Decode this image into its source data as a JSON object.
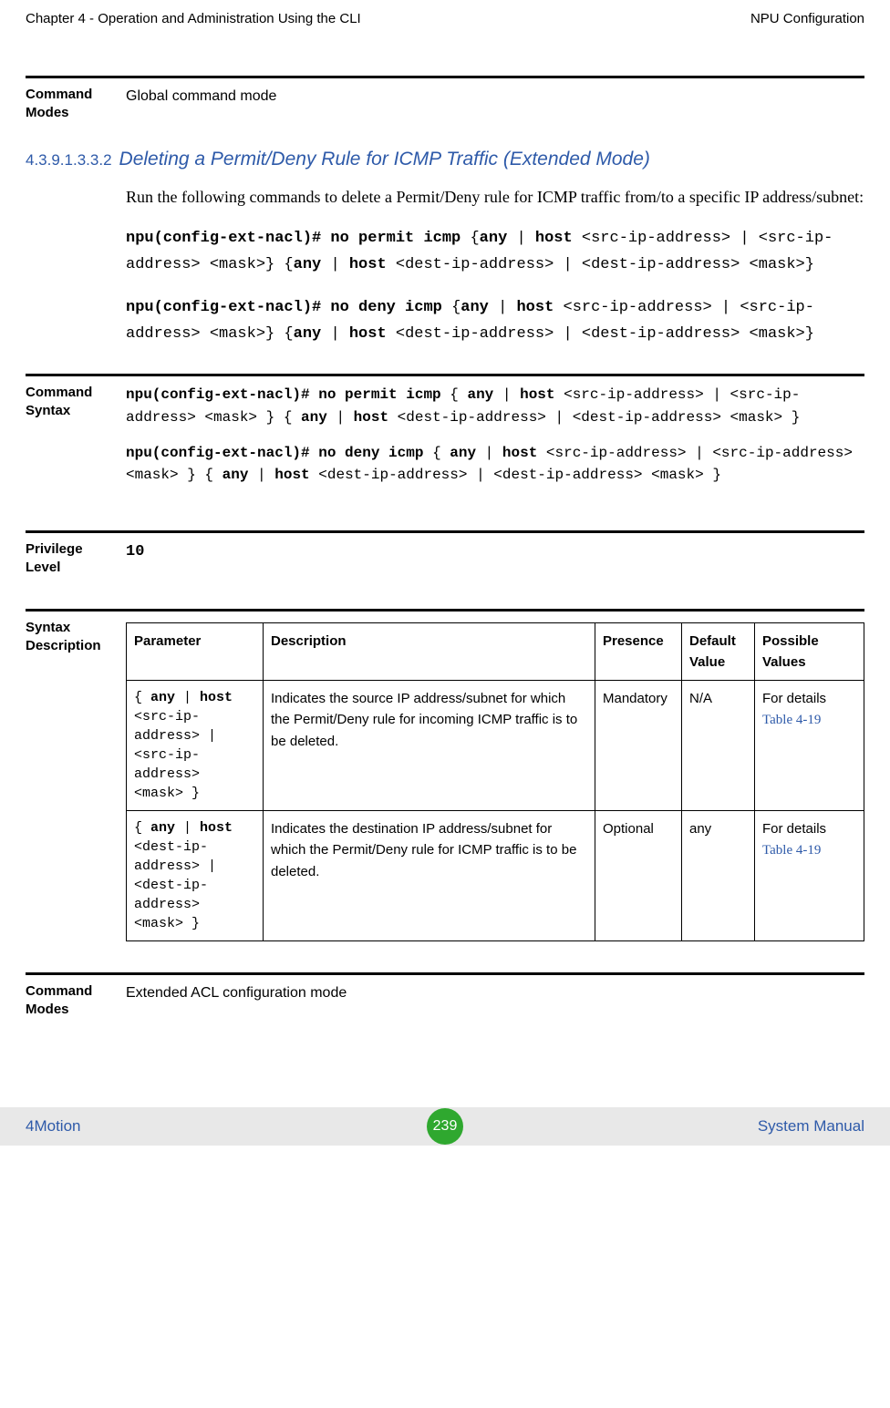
{
  "header": {
    "left": "Chapter 4 - Operation and Administration Using the CLI",
    "right": "NPU Configuration"
  },
  "block_modes_top": {
    "label": "Command Modes",
    "value": "Global command mode"
  },
  "section": {
    "number": "4.3.9.1.3.3.2",
    "title": "Deleting a Permit/Deny Rule for ICMP Traffic (Extended Mode)"
  },
  "intro": "Run the following commands to delete a Permit/Deny rule for ICMP traffic from/to a specific IP address/subnet:",
  "cmd1": {
    "p1_b": "npu(config-ext-nacl)# no permit icmp ",
    "p1_nb": "{",
    "p2_b": "any",
    "p2_nb": " | ",
    "p3_b": "host",
    "p3_nb": " <src-ip-address> | <src-ip-address> <mask>} {",
    "p4_b": "any",
    "p4_nb": " | ",
    "p5_b": "host",
    "p5_nb": " <dest-ip-address> | <dest-ip-address> <mask>}"
  },
  "cmd2": {
    "p1_b": "npu(config-ext-nacl)# no deny icmp ",
    "p1_nb": "{",
    "p2_b": "any",
    "p2_nb": " | ",
    "p3_b": "host",
    "p3_nb": " <src-ip-address> | <src-ip-address> <mask>} {",
    "p4_b": "any",
    "p4_nb": " | ",
    "p5_b": "host",
    "p5_nb": " <dest-ip-address> | <dest-ip-address> <mask>}"
  },
  "block_syntax": {
    "label": "Command Syntax",
    "line1": {
      "a_b": "npu(config-ext-nacl)# no permit icmp ",
      "a_nb": "{ ",
      "b_b": "any",
      "b_nb": " | ",
      "c_b": "host",
      "c_nb": " <src-ip-address> | <src-ip-address> <mask> }  { ",
      "d_b": "any",
      "d_nb": " | ",
      "e_b": "host",
      "e_nb": " <dest-ip-address> | <dest-ip-address> <mask> }"
    },
    "line2": {
      "a_b": "npu(config-ext-nacl)# no deny icmp ",
      "a_nb": "{ ",
      "b_b": "any",
      "b_nb": " | ",
      "c_b": "host",
      "c_nb": " <src-ip-address> | <src-ip-address> <mask> }  { ",
      "d_b": "any",
      "d_nb": " | ",
      "e_b": "host",
      "e_nb": " <dest-ip-address> | <dest-ip-address> <mask> }"
    }
  },
  "block_priv": {
    "label": "Privilege Level",
    "value": "10"
  },
  "block_desc": {
    "label": "Syntax Description",
    "headers": {
      "param": "Parameter",
      "desc": "Description",
      "presence": "Presence",
      "default": "Default Value",
      "possible": "Possible Values"
    },
    "rows": [
      {
        "param": {
          "a": "{ ",
          "b_b": "any",
          "b_nb": " | ",
          "c_b": "host",
          "c_nb": " <src-ip-address> | <src-ip-address> <mask> }"
        },
        "desc": "Indicates the source IP address/subnet for which the Permit/Deny rule for incoming ICMP traffic is to be deleted.",
        "presence": "Mandatory",
        "default": "N/A",
        "possible_pre": "For details ",
        "possible_link": "Table 4-19"
      },
      {
        "param": {
          "a": "{ ",
          "b_b": "any",
          "b_nb": " | ",
          "c_b": "host",
          "c_nb": " <dest-ip-address> | <dest-ip-address> <mask> }"
        },
        "desc": "Indicates the destination IP address/subnet for which the Permit/Deny rule for ICMP traffic is to be deleted.",
        "presence": "Optional",
        "default": "any",
        "possible_pre": "For details ",
        "possible_link": "Table 4-19"
      }
    ]
  },
  "block_modes_bottom": {
    "label": "Command Modes",
    "value": "Extended ACL configuration mode"
  },
  "footer": {
    "left": "4Motion",
    "page": "239",
    "right": "System Manual"
  }
}
